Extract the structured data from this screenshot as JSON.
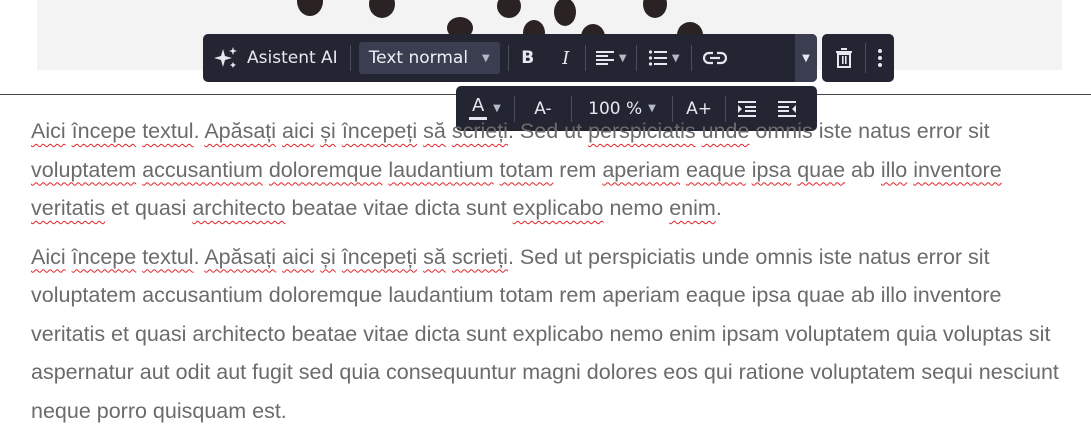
{
  "toolbar": {
    "ai_label": "Asistent AI",
    "text_style": "Text normal",
    "bold": "B",
    "italic": "I",
    "zoom": "100 %",
    "font_color_letter": "A",
    "decrease_size": "A-",
    "increase_size": "A+",
    "icons": [
      "sparkle-icon",
      "bold-icon",
      "italic-icon",
      "align-icon",
      "list-icon",
      "link-icon",
      "chevron-down-icon",
      "trash-icon",
      "more-vertical-icon",
      "font-color-icon",
      "decrease-font-icon",
      "increase-font-icon",
      "indent-icon",
      "outdent-icon"
    ]
  },
  "content": {
    "p1_s1": "Aici",
    "p1_s2": " ",
    "p1_s3": "începe",
    "p1_s4": " ",
    "p1_s5": "textul",
    "p1_s6": ". ",
    "p1_s7": "Apăsați",
    "p1_s8": " ",
    "p1_s9": "aici",
    "p1_s10": " ",
    "p1_s11": "și",
    "p1_s12": " ",
    "p1_s13": "începeți",
    "p1_s14": " ",
    "p1_s15": "să",
    "p1_s16": " ",
    "p1_s17": "scrieți",
    "p1_s18": ". Sed ut ",
    "p1_s19": "perspiciatis",
    "p1_s20": " ",
    "p1_s21": "unde",
    "p1_s22": " omnis iste natus error sit ",
    "p1_s23": "voluptatem",
    "p1_s24": " ",
    "p1_s25": "accusantium",
    "p1_s26": " ",
    "p1_s27": "doloremque",
    "p1_s28": " ",
    "p1_s29": "laudantium",
    "p1_s30": " ",
    "p1_s31": "totam",
    "p1_s32": " rem ",
    "p1_s33": "aperiam",
    "p1_s34": " ",
    "p1_s35": "eaque",
    "p1_s36": " ",
    "p1_s37": "ipsa",
    "p1_s38": " ",
    "p1_s39": "quae",
    "p1_s40": " ab ",
    "p1_s41": "illo",
    "p1_s42": " ",
    "p1_s43": "inventore",
    "p1_s44": " ",
    "p1_s45": "veritatis",
    "p1_s46": " et quasi ",
    "p1_s47": "architecto",
    "p1_s48": " beatae vitae dicta sunt ",
    "p1_s49": "explicabo",
    "p1_s50": " nemo ",
    "p1_s51": "enim",
    "p1_s52": ".",
    "p2_s1": "Aici",
    "p2_s2": " ",
    "p2_s3": "începe",
    "p2_s4": " ",
    "p2_s5": "textul",
    "p2_s6": ". ",
    "p2_s7": "Apăsați",
    "p2_s8": " ",
    "p2_s9": "aici",
    "p2_s10": " ",
    "p2_s11": "și",
    "p2_s12": " ",
    "p2_s13": "începeți",
    "p2_s14": " ",
    "p2_s15": "să",
    "p2_s16": " ",
    "p2_s17": "scrieți",
    "p2_rest": ". Sed ut perspiciatis unde omnis iste natus error sit voluptatem accusantium doloremque laudantium totam rem aperiam eaque ipsa quae ab illo inventore veritatis et quasi architecto beatae vitae dicta sunt explicabo nemo enim ipsam voluptatem quia voluptas sit aspernatur aut odit aut fugit sed quia consequuntur magni dolores eos qui ratione voluptatem sequi nesciunt neque porro quisquam est."
  },
  "colors": {
    "toolbar_bg": "#232632",
    "text": "#6b6b6b",
    "spellcheck": "#e0242b"
  }
}
